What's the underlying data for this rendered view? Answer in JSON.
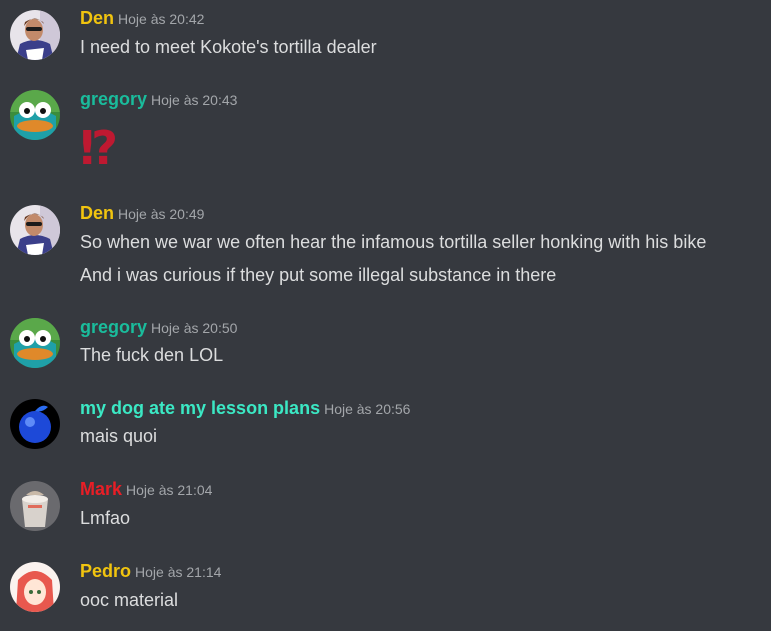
{
  "colors": {
    "background": "#36393f",
    "den": "#f1c40f",
    "gregory": "#1abc9c",
    "dog": "#3be8c4",
    "mark": "#e91e26",
    "pedro": "#f1c40f",
    "timestamp": "#a3a6aa",
    "text": "#dcddde"
  },
  "messages": [
    {
      "author": "Den",
      "timestamp": "Hoje às 20:42",
      "avatar_icon": "man-with-sunglasses-avatar",
      "lines": [
        "I need to meet Kokote's tortilla dealer"
      ]
    },
    {
      "author": "gregory",
      "timestamp": "Hoje às 20:43",
      "avatar_icon": "perry-platypus-avatar",
      "emoji": "⁉",
      "emoji_name": "interrobang-emoji"
    },
    {
      "author": "Den",
      "timestamp": "Hoje às 20:49",
      "avatar_icon": "man-with-sunglasses-avatar",
      "lines": [
        "So when we war we often hear the infamous tortilla seller honking with his bike",
        "And i was curious if they put some illegal substance in there"
      ]
    },
    {
      "author": "gregory",
      "timestamp": "Hoje às 20:50",
      "avatar_icon": "perry-platypus-avatar",
      "lines": [
        "The fuck den LOL"
      ]
    },
    {
      "author": "my dog ate my lesson plans",
      "timestamp": "Hoje às 20:56",
      "avatar_icon": "blue-apple-avatar",
      "lines": [
        "mais quoi"
      ]
    },
    {
      "author": "Mark",
      "timestamp": "Hoje às 21:04",
      "avatar_icon": "cup-character-avatar",
      "lines": [
        "Lmfao"
      ]
    },
    {
      "author": "Pedro",
      "timestamp": "Hoje às 21:14",
      "avatar_icon": "anime-girl-avatar",
      "lines": [
        "ooc material"
      ]
    }
  ]
}
